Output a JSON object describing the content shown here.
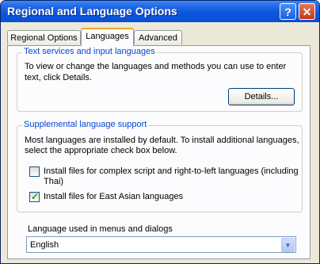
{
  "window": {
    "title": "Regional and Language Options",
    "help_label": "?",
    "close_label": "✕"
  },
  "tabs": [
    {
      "label": "Regional Options"
    },
    {
      "label": "Languages"
    },
    {
      "label": "Advanced"
    }
  ],
  "text_services": {
    "legend": "Text services and input languages",
    "description_line1": "To view or change the languages and methods you can use to enter",
    "description_line2": "text, click Details.",
    "details_button": "Details..."
  },
  "supplemental": {
    "legend": "Supplemental language support",
    "description_line1": "Most languages are installed by default. To install additional languages,",
    "description_line2": "select the appropriate check box below.",
    "checkboxes": [
      {
        "label_line1": "Install files for complex script and right-to-left languages (including",
        "label_line2": "Thai)",
        "checked": false
      },
      {
        "label_line1": "Install files for East Asian languages",
        "label_line2": "",
        "checked": true
      }
    ]
  },
  "menu_language": {
    "label": "Language used in menus and dialogs",
    "selected": "English"
  }
}
